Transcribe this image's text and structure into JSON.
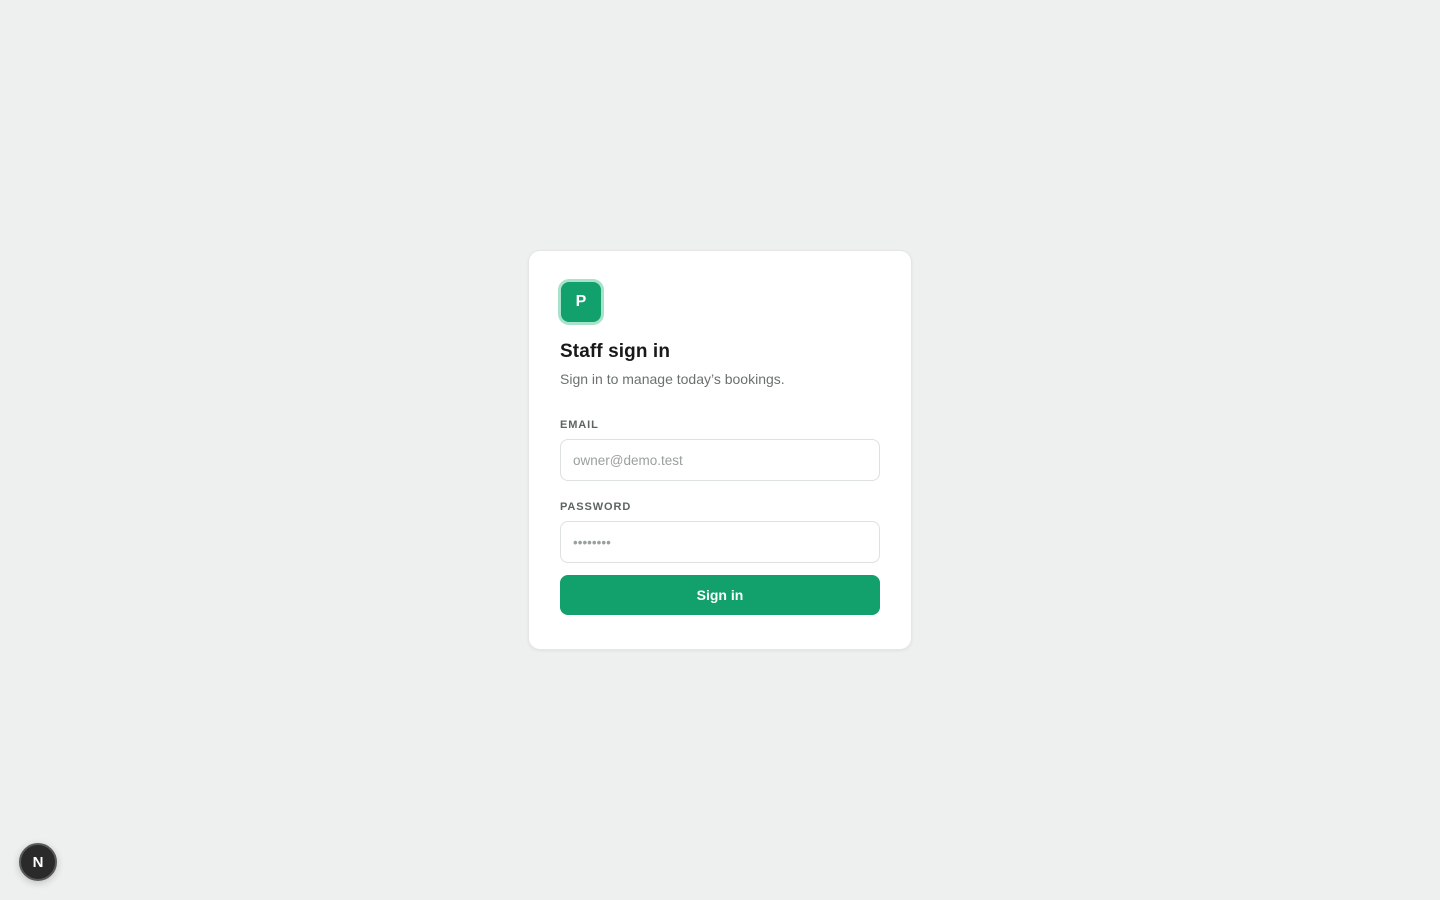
{
  "card": {
    "logo_letter": "P",
    "title": "Staff sign in",
    "subtitle": "Sign in to manage today’s bookings.",
    "email": {
      "label": "EMAIL",
      "placeholder": "owner@demo.test",
      "value": ""
    },
    "password": {
      "label": "PASSWORD",
      "placeholder": "••••••••",
      "value": ""
    },
    "submit_label": "Sign in"
  },
  "dev_badge": {
    "letter": "N",
    "icon": "nextjs-icon"
  },
  "colors": {
    "background": "#eef0ef",
    "accent": "#12a06d",
    "accent_ring": "#a7e3cb",
    "text_primary": "#17191a",
    "text_secondary": "#6b716e"
  }
}
